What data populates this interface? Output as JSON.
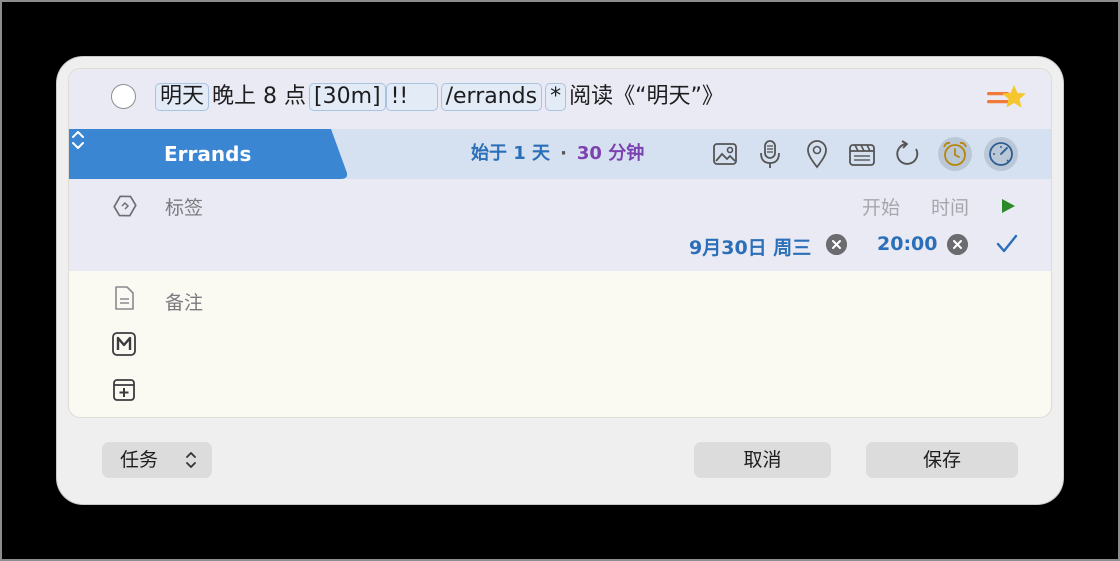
{
  "task": {
    "tokens": [
      {
        "text": "明天",
        "highlight": true
      },
      {
        "text": "晚上 8 点",
        "highlight": false
      },
      {
        "text": "[30m]",
        "highlight": true
      },
      {
        "text": "!! ",
        "highlight": true
      },
      {
        "text": "/errands",
        "highlight": true
      },
      {
        "text": "*",
        "highlight": true
      },
      {
        "text": "阅读《“明天”》",
        "highlight": false
      }
    ]
  },
  "list": {
    "name": "Errands",
    "color": "#3b86d2"
  },
  "duration": {
    "start": "始于 1 天",
    "separator": "·",
    "length": "30 分钟"
  },
  "toolbar": {
    "icons": [
      "image-icon",
      "microphone-icon",
      "location-icon",
      "clapperboard-icon",
      "repeat-icon",
      "alarm-clock-icon",
      "deadline-gauge-icon"
    ]
  },
  "tags": {
    "label": "标签"
  },
  "schedule": {
    "start_label": "开始",
    "time_label": "时间",
    "date": "9月30日 周三",
    "time": "20:00"
  },
  "notes": {
    "placeholder": "备注"
  },
  "footer": {
    "type_label": "任务",
    "cancel_label": "取消",
    "save_label": "保存"
  },
  "colors": {
    "accent_blue": "#2b6fb8",
    "duration_purple": "#7b42b0",
    "play_green": "#2a8a2a"
  }
}
